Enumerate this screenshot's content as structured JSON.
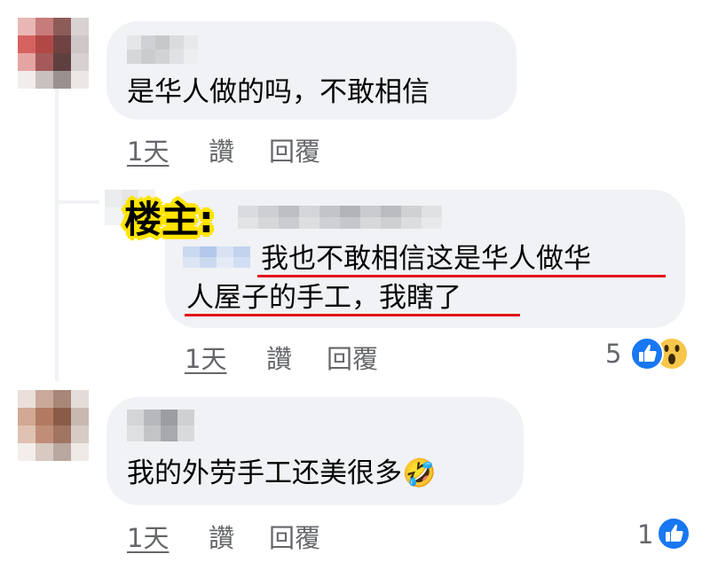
{
  "comments": [
    {
      "text": "是华人做的吗，不敢相信",
      "actions": {
        "time": "1天",
        "like": "讚",
        "reply": "回覆"
      }
    },
    {
      "op_tag": "楼主:",
      "text_line1": "我也不敢相信这是华人做华",
      "text_line2": "人屋子的手工，我瞎了",
      "actions": {
        "time": "1天",
        "like": "讚",
        "reply": "回覆"
      },
      "reactions": {
        "count": "5",
        "icons": [
          "like-icon",
          "wow-icon"
        ]
      }
    },
    {
      "text": "我的外劳手工还美很多🤣",
      "actions": {
        "time": "1天",
        "like": "讚",
        "reply": "回覆"
      },
      "reactions": {
        "count": "1",
        "icons": [
          "like-icon"
        ]
      }
    }
  ],
  "colors": {
    "bubble": "#f0f2f5",
    "secondary_text": "#65676b",
    "highlight_underline": "#e4141b",
    "op_tag_outline": "#ffe400",
    "like_blue": "#1877f2"
  }
}
